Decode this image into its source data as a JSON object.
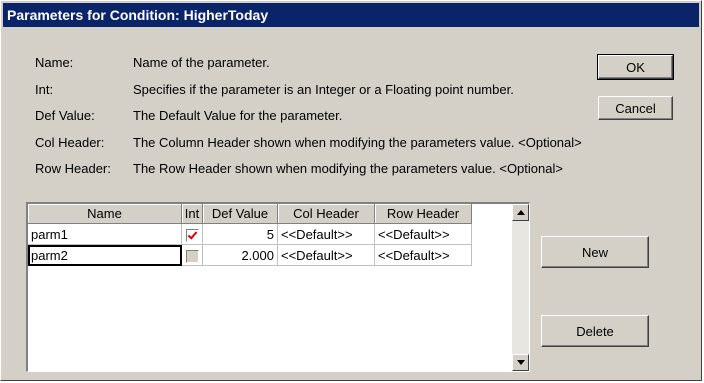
{
  "dialog": {
    "title": "Parameters for Condition: HigherToday"
  },
  "descriptions": [
    {
      "key": "Name:",
      "text": "Name of the parameter."
    },
    {
      "key": "Int:",
      "text": "Specifies if the parameter is an Integer or a Floating point number."
    },
    {
      "key": "Def Value:",
      "text": "The Default Value for the parameter."
    },
    {
      "key": "Col Header:",
      "text": "The Column Header shown when modifying the parameters value. <Optional>"
    },
    {
      "key": "Row Header:",
      "text": "The Row Header shown when modifying the parameters value. <Optional>"
    }
  ],
  "buttons": {
    "ok": "OK",
    "cancel": "Cancel",
    "new": "New",
    "delete": "Delete"
  },
  "grid": {
    "columns": [
      "Name",
      "Int",
      "Def Value",
      "Col Header",
      "Row Header"
    ],
    "rows": [
      {
        "name": "parm1",
        "int": true,
        "def_value": "5",
        "col_header": "<<Default>>",
        "row_header": "<<Default>>"
      },
      {
        "name": "parm2",
        "int": false,
        "def_value": "2.000",
        "col_header": "<<Default>>",
        "row_header": "<<Default>>"
      }
    ]
  },
  "icons": {
    "check": "check-icon",
    "scroll_up": "scroll-up-arrow-icon",
    "scroll_down": "scroll-down-arrow-icon"
  },
  "colors": {
    "titlebar": "#0a246a",
    "dialog_face": "#d4d0c8",
    "checkmark": "#e00000"
  }
}
